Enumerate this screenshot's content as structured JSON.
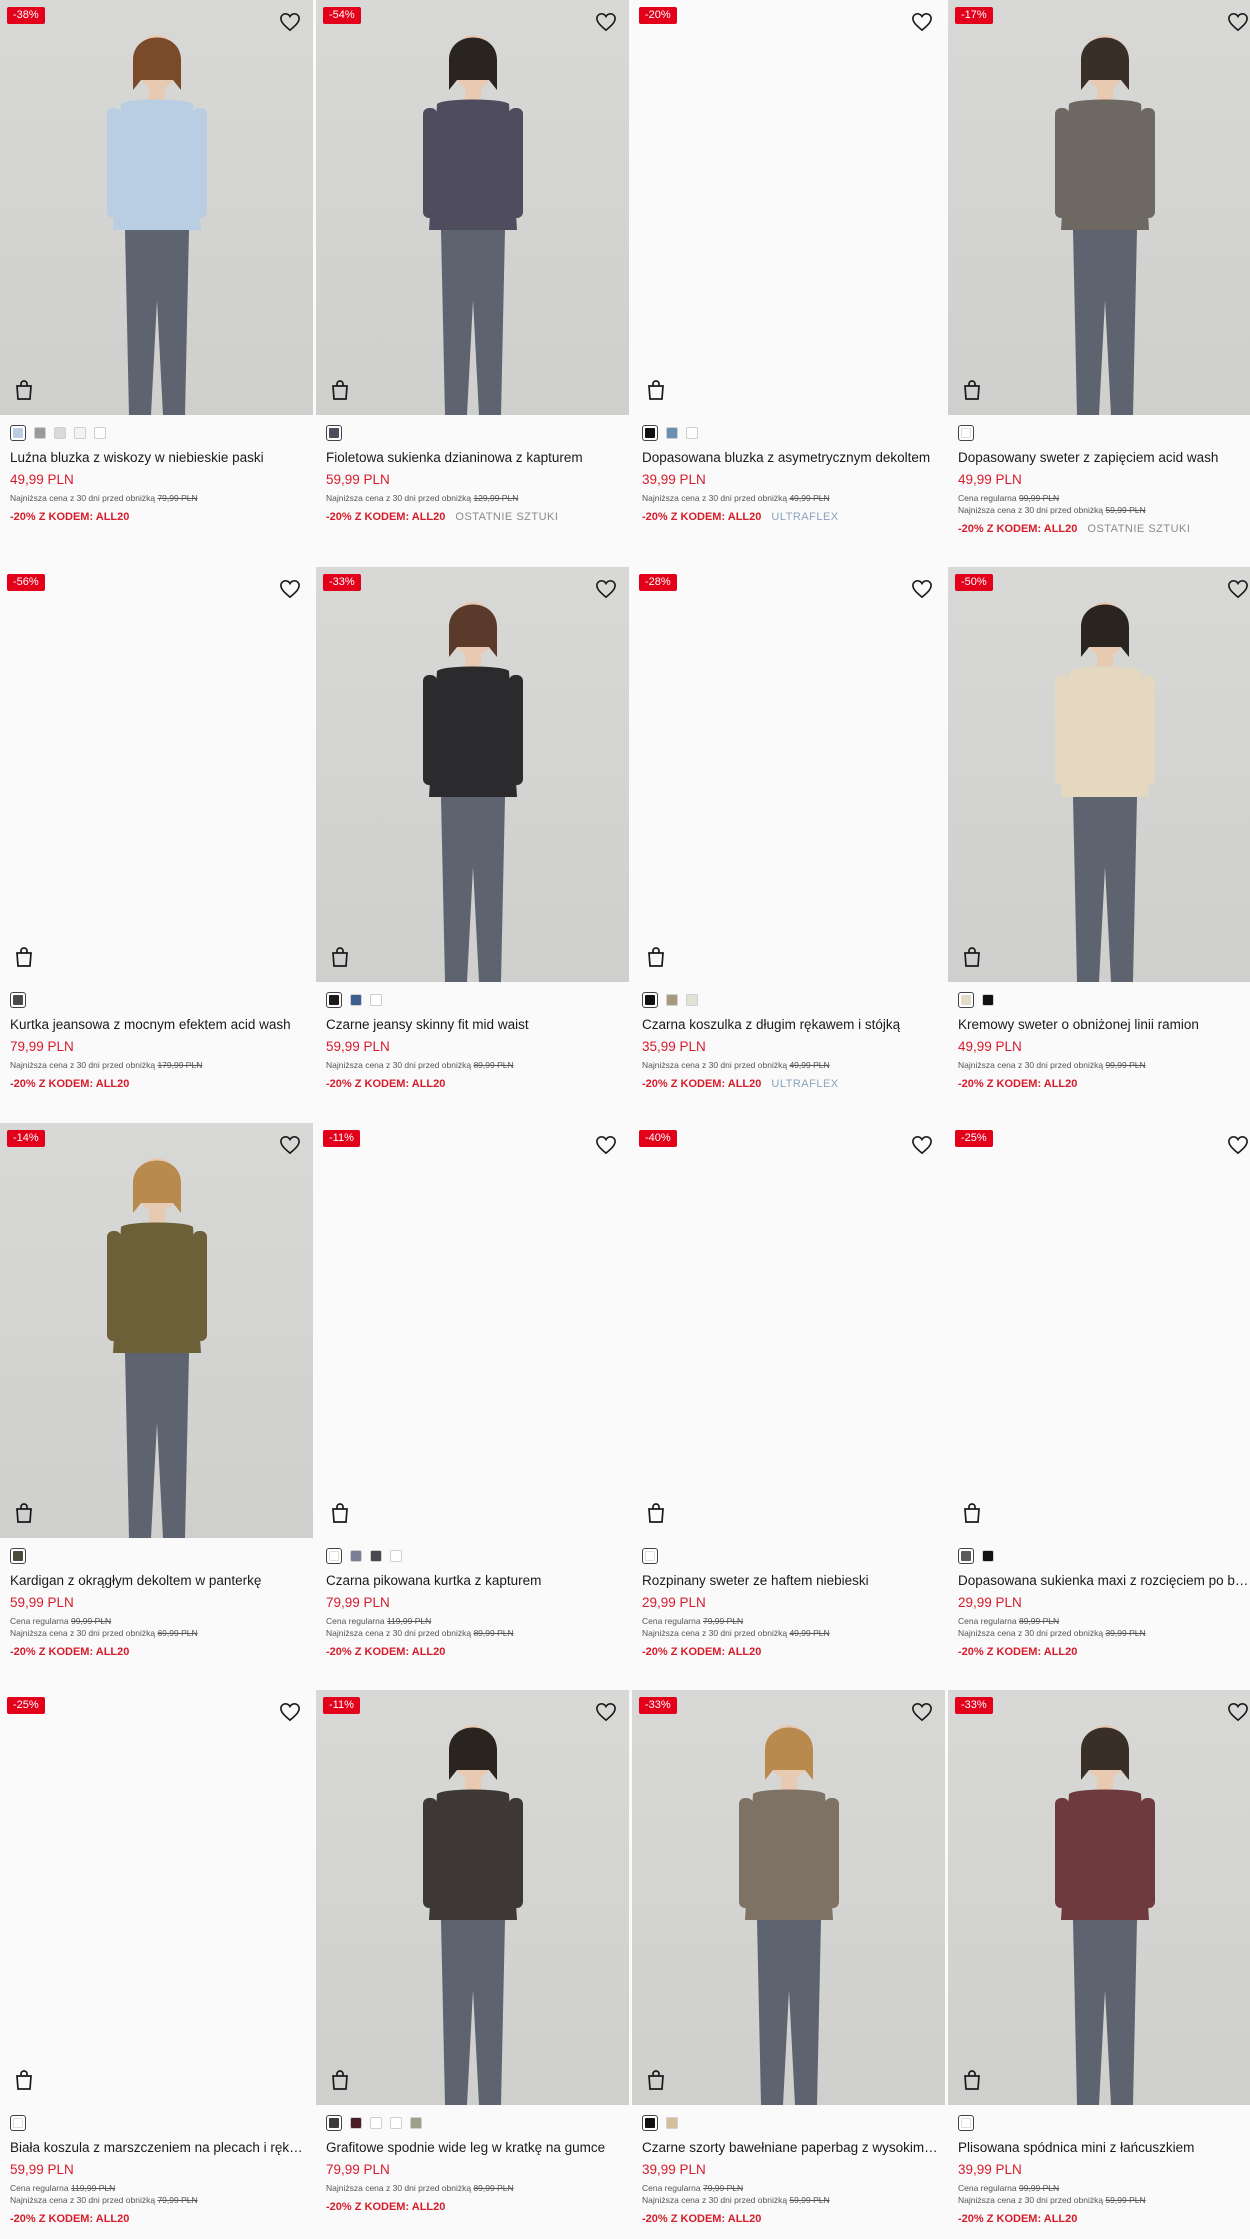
{
  "products": [
    {
      "badge": "-38%",
      "name": "Luźna bluzka z wiskozy w niebieskie paski",
      "price": "49,99 PLN",
      "regular_label": "",
      "regular_price": "",
      "lowest_label": "Najniższa cena z 30 dni przed obniżką",
      "lowest_price": "79,99 PLN",
      "code": "-20% Z KODEM: ALL20",
      "tag": "",
      "photo": true,
      "photo_color": "#b9cde3",
      "swatches": [
        "#b9cde3",
        "#9a9a9a",
        "#d9d9d9",
        "#f2f2f2",
        "#ffffff"
      ]
    },
    {
      "badge": "-54%",
      "name": "Fioletowa sukienka dzianinowa z kapturem",
      "price": "59,99 PLN",
      "regular_label": "",
      "regular_price": "",
      "lowest_label": "Najniższa cena z 30 dni przed obniżką",
      "lowest_price": "129,99 PLN",
      "code": "-20% Z KODEM: ALL20",
      "tag": "OSTATNIE SZTUKI",
      "tag_style": "grey",
      "photo": true,
      "photo_color": "#4f4c5e",
      "swatches": [
        "#4f4c5e"
      ]
    },
    {
      "badge": "-20%",
      "name": "Dopasowana bluzka z asymetrycznym dekoltem",
      "price": "39,99 PLN",
      "regular_label": "",
      "regular_price": "",
      "lowest_label": "Najniższa cena z 30 dni przed obniżką",
      "lowest_price": "49,99 PLN",
      "code": "-20% Z KODEM: ALL20",
      "tag": "ULTRAFLEX",
      "tag_style": "blue",
      "photo": false,
      "swatches": [
        "#111111",
        "#6b8fb3",
        "#ffffff"
      ]
    },
    {
      "badge": "-17%",
      "name": "Dopasowany sweter z zapięciem acid wash",
      "price": "49,99 PLN",
      "regular_label": "Cena regularna",
      "regular_price": "99,99 PLN",
      "lowest_label": "Najniższa cena z 30 dni przed obniżką",
      "lowest_price": "59,99 PLN",
      "code": "-20% Z KODEM: ALL20",
      "tag": "OSTATNIE SZTUKI",
      "tag_style": "grey",
      "photo": true,
      "photo_color": "#6d6862",
      "swatches": [
        "#ffffff"
      ]
    },
    {
      "badge": "-56%",
      "name": "Kurtka jeansowa z mocnym efektem acid wash",
      "price": "79,99 PLN",
      "regular_label": "",
      "regular_price": "",
      "lowest_label": "Najniższa cena z 30 dni przed obniżką",
      "lowest_price": "179,99 PLN",
      "code": "-20% Z KODEM: ALL20",
      "tag": "",
      "photo": false,
      "swatches": [
        "#4a4a4a"
      ]
    },
    {
      "badge": "-33%",
      "name": "Czarne jeansy skinny fit mid waist",
      "price": "59,99 PLN",
      "regular_label": "",
      "regular_price": "",
      "lowest_label": "Najniższa cena z 30 dni przed obniżką",
      "lowest_price": "89,99 PLN",
      "code": "-20% Z KODEM: ALL20",
      "tag": "",
      "photo": true,
      "photo_color": "#2b2b2e",
      "swatches": [
        "#1c1c1c",
        "#3d5f8f",
        "#ffffff"
      ]
    },
    {
      "badge": "-28%",
      "name": "Czarna koszulka z długim rękawem i stójką",
      "price": "35,99 PLN",
      "regular_label": "",
      "regular_price": "",
      "lowest_label": "Najniższa cena z 30 dni przed obniżką",
      "lowest_price": "49,99 PLN",
      "code": "-20% Z KODEM: ALL20",
      "tag": "ULTRAFLEX",
      "tag_style": "blue",
      "photo": false,
      "swatches": [
        "#111111",
        "#a89a80",
        "#e3e0d6"
      ]
    },
    {
      "badge": "-50%",
      "name": "Kremowy sweter o obniżonej linii ramion",
      "price": "49,99 PLN",
      "regular_label": "",
      "regular_price": "",
      "lowest_label": "Najniższa cena z 30 dni przed obniżką",
      "lowest_price": "99,99 PLN",
      "code": "-20% Z KODEM: ALL20",
      "tag": "",
      "photo": true,
      "photo_color": "#e4d8c1",
      "swatches": [
        "#e4dcc9",
        "#111111"
      ]
    },
    {
      "badge": "-14%",
      "name": "Kardigan z okrągłym dekoltem w panterkę",
      "price": "59,99 PLN",
      "regular_label": "Cena regularna",
      "regular_price": "99,99 PLN",
      "lowest_label": "Najniższa cena z 30 dni przed obniżką",
      "lowest_price": "69,99 PLN",
      "code": "-20% Z KODEM: ALL20",
      "tag": "",
      "photo": true,
      "photo_color": "#6b6038",
      "swatches": [
        "#4a4a3a"
      ]
    },
    {
      "badge": "-11%",
      "name": "Czarna pikowana kurtka z kapturem",
      "price": "79,99 PLN",
      "regular_label": "Cena regularna",
      "regular_price": "119,99 PLN",
      "lowest_label": "Najniższa cena z 30 dni przed obniżką",
      "lowest_price": "89,99 PLN",
      "code": "-20% Z KODEM: ALL20",
      "tag": "",
      "photo": false,
      "swatches": [
        "#ffffff",
        "#7a7f94",
        "#4b4750",
        "#ffffff"
      ]
    },
    {
      "badge": "-40%",
      "name": "Rozpinany sweter ze haftem niebieski",
      "price": "29,99 PLN",
      "regular_label": "Cena regularna",
      "regular_price": "79,99 PLN",
      "lowest_label": "Najniższa cena z 30 dni przed obniżką",
      "lowest_price": "49,99 PLN",
      "code": "-20% Z KODEM: ALL20",
      "tag": "",
      "photo": false,
      "swatches": [
        "#ffffff"
      ]
    },
    {
      "badge": "-25%",
      "name": "Dopasowana sukienka maxi z rozcięciem po boku",
      "price": "29,99 PLN",
      "regular_label": "Cena regularna",
      "regular_price": "89,99 PLN",
      "lowest_label": "Najniższa cena z 30 dni przed obniżką",
      "lowest_price": "39,99 PLN",
      "code": "-20% Z KODEM: ALL20",
      "tag": "",
      "photo": false,
      "swatches": [
        "#5a5a5a",
        "#111111"
      ]
    },
    {
      "badge": "-25%",
      "name": "Biała koszula z marszczeniem na plecach i rękawach",
      "price": "59,99 PLN",
      "regular_label": "Cena regularna",
      "regular_price": "119,99 PLN",
      "lowest_label": "Najniższa cena z 30 dni przed obniżką",
      "lowest_price": "79,99 PLN",
      "code": "-20% Z KODEM: ALL20",
      "tag": "",
      "photo": false,
      "swatches": [
        "#ffffff"
      ]
    },
    {
      "badge": "-11%",
      "name": "Grafitowe spodnie wide leg w kratkę na gumce",
      "price": "79,99 PLN",
      "regular_label": "",
      "regular_price": "",
      "lowest_label": "Najniższa cena z 30 dni przed obniżką",
      "lowest_price": "89,99 PLN",
      "code": "-20% Z KODEM: ALL20",
      "tag": "",
      "photo": true,
      "photo_color": "#3d3836",
      "swatches": [
        "#3b3b3b",
        "#4a1d25",
        "#ffffff",
        "#ffffff",
        "#9aa08a"
      ]
    },
    {
      "badge": "-33%",
      "name": "Czarne szorty bawełniane paperbag z wysokim stanem",
      "price": "39,99 PLN",
      "regular_label": "Cena regularna",
      "regular_price": "79,99 PLN",
      "lowest_label": "Najniższa cena z 30 dni przed obniżką",
      "lowest_price": "59,99 PLN",
      "code": "-20% Z KODEM: ALL20",
      "tag": "",
      "photo": true,
      "photo_color": "#7d7263",
      "swatches": [
        "#111111",
        "#d3c09a"
      ]
    },
    {
      "badge": "-33%",
      "name": "Plisowana spódnica mini z łańcuszkiem",
      "price": "39,99 PLN",
      "regular_label": "Cena regularna",
      "regular_price": "99,99 PLN",
      "lowest_label": "Najniższa cena z 30 dni przed obniżką",
      "lowest_price": "59,99 PLN",
      "code": "-20% Z KODEM: ALL20",
      "tag": "",
      "photo": true,
      "photo_color": "#6e3a3e",
      "swatches": [
        "#ffffff"
      ]
    }
  ]
}
